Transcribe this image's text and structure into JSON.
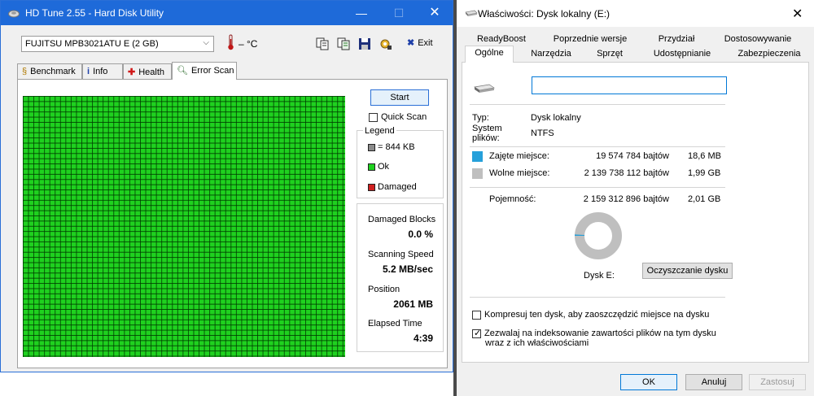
{
  "hdtune": {
    "title": "HD Tune 2.55 - Hard Disk Utility",
    "drive": "FUJITSU MPB3021ATU E (2 GB)",
    "temperature": "– °C",
    "exit_label": "Exit",
    "tabs": [
      {
        "label": "Benchmark",
        "icon": "chart-icon"
      },
      {
        "label": "Info",
        "icon": "info-icon"
      },
      {
        "label": "Health",
        "icon": "health-icon"
      },
      {
        "label": "Error Scan",
        "icon": "magnifier-icon"
      }
    ],
    "active_tab": "Error Scan",
    "start_label": "Start",
    "quick_scan_label": "Quick Scan",
    "quick_scan_checked": false,
    "legend": {
      "title": "Legend",
      "block_size": "= 844 KB",
      "ok_label": "Ok",
      "damaged_label": "Damaged"
    },
    "stats": {
      "damaged_blocks_label": "Damaged Blocks",
      "damaged_blocks_value": "0.0 %",
      "scanning_speed_label": "Scanning Speed",
      "scanning_speed_value": "5.2 MB/sec",
      "position_label": "Position",
      "position_value": "2061 MB",
      "elapsed_label": "Elapsed Time",
      "elapsed_value": "4:39"
    },
    "colors": {
      "ok": "#1fd11f",
      "damaged": "#d02020",
      "titlebar": "#1e6ad9"
    }
  },
  "props": {
    "title": "Właściwości: Dysk lokalny (E:)",
    "tabs_row1": [
      "ReadyBoost",
      "Poprzednie wersje",
      "Przydział",
      "Dostosowywanie"
    ],
    "tabs_row2": [
      "Ogólne",
      "Narzędzia",
      "Sprzęt",
      "Udostępnianie",
      "Zabezpieczenia"
    ],
    "active_tab": "Ogólne",
    "name_value": "",
    "type_label": "Typ:",
    "type_value": "Dysk lokalny",
    "fs_label": "System plików:",
    "fs_value": "NTFS",
    "used_label": "Zajęte miejsce:",
    "used_bytes": "19 574 784 bajtów",
    "used_size": "18,6 MB",
    "free_label": "Wolne miejsce:",
    "free_bytes": "2 139 738 112 bajtów",
    "free_size": "1,99 GB",
    "capacity_label": "Pojemność:",
    "capacity_bytes": "2 159 312 896 bajtów",
    "capacity_size": "2,01 GB",
    "used_fraction": 0.0091,
    "used_color": "#26a0da",
    "free_color": "#bfbfbf",
    "disk_label": "Dysk E:",
    "cleanup_label": "Oczyszczanie dysku",
    "compress_label": "Kompresuj ten dysk, aby zaoszczędzić miejsce na dysku",
    "compress_checked": false,
    "index_label_line1": "Zezwalaj na indeksowanie zawartości plików na tym dysku",
    "index_label_line2": "wraz z ich właściwościami",
    "index_checked": true,
    "ok_label": "OK",
    "cancel_label": "Anuluj",
    "apply_label": "Zastosuj"
  }
}
